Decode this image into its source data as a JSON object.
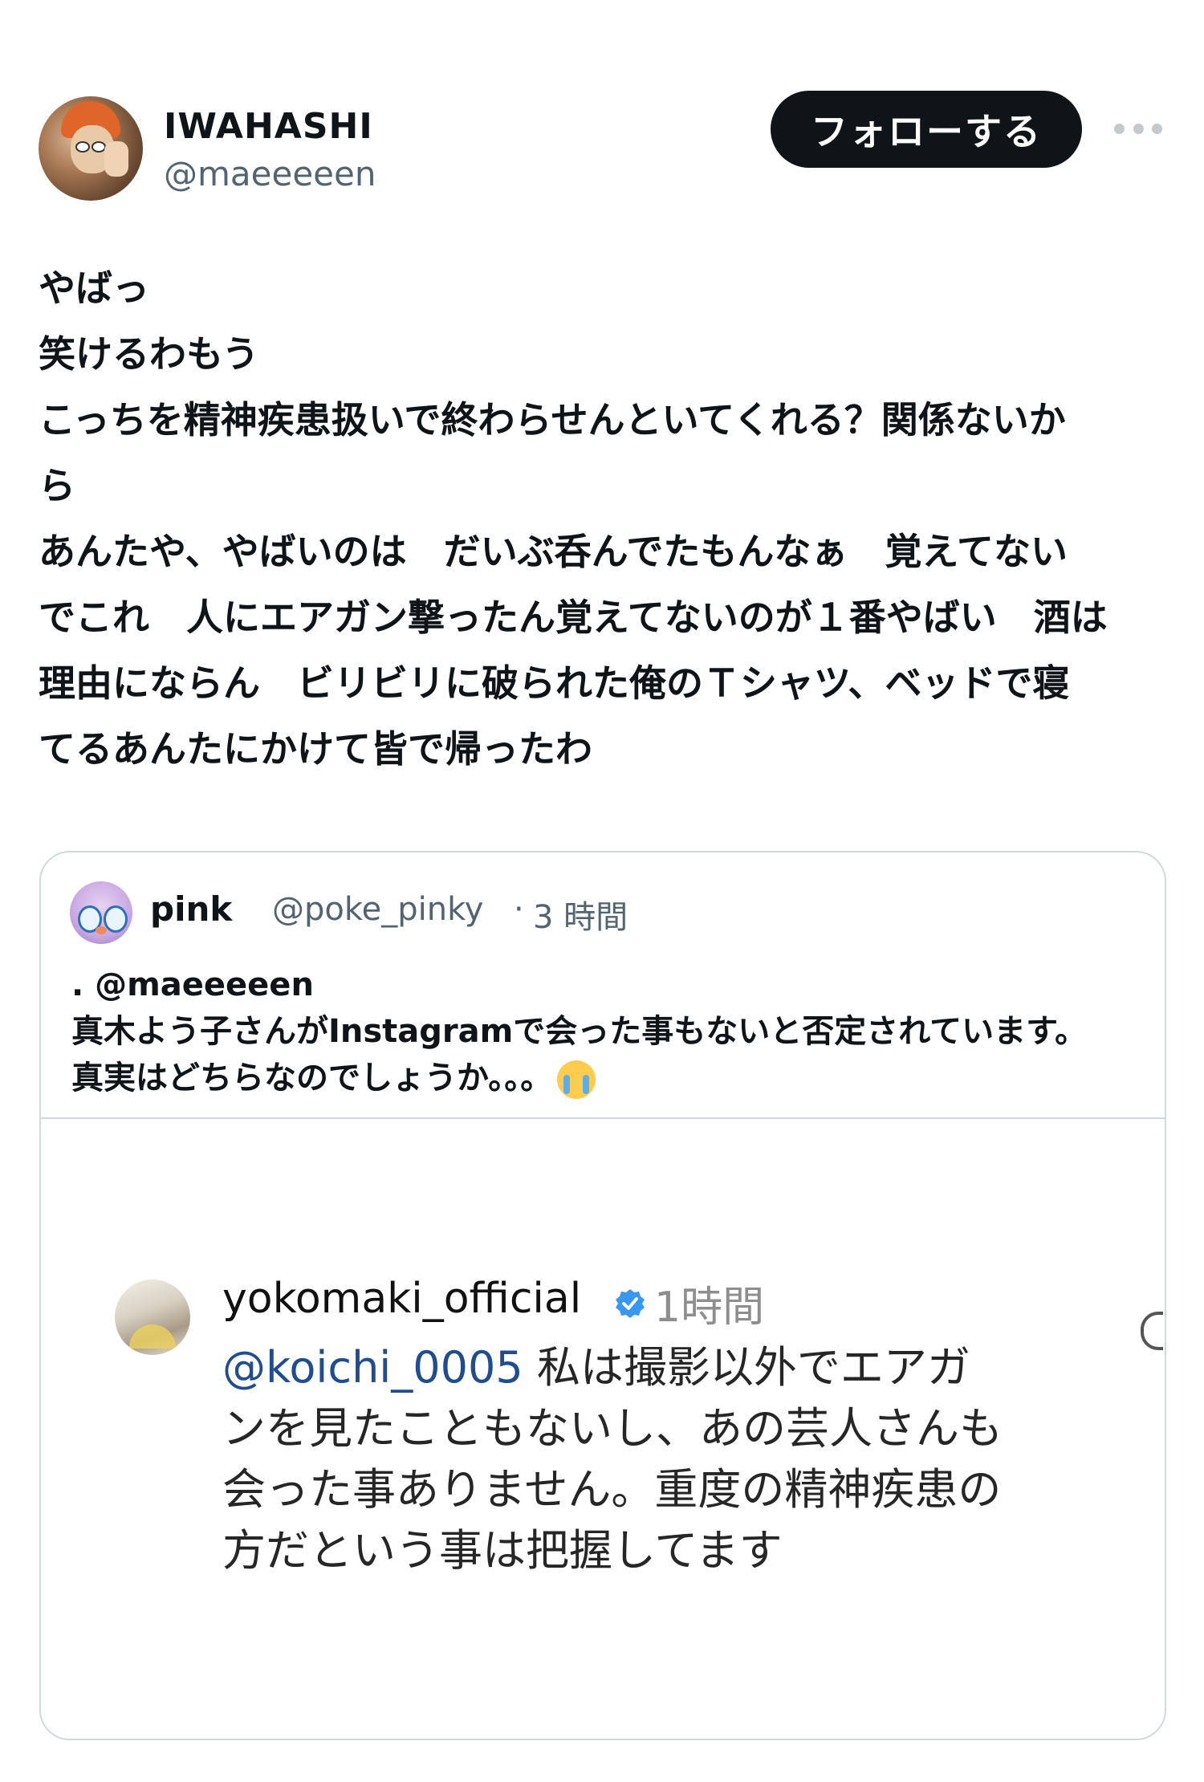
{
  "post": {
    "author": {
      "display_name": "IWAHASHI",
      "handle": "@maeeeeen"
    },
    "follow_label": "フォローする",
    "more_icon": "ellipsis-icon",
    "body_lines": [
      "やばっ",
      "笑けるわもう",
      "こっちを精神疾患扱いで終わらせんといてくれる？関係ないか",
      "ら",
      "あんたや、やばいのは　だいぶ呑んでたもんなぁ　覚えてない",
      "でこれ　人にエアガン撃ったん覚えてないのが１番やばい　酒は",
      "理由にならん　ビリビリに破られた俺のＴシャツ、ベッドで寝",
      "てるあんたにかけて皆で帰ったわ"
    ]
  },
  "quote": {
    "name": "pink",
    "handle": "@poke_pinky",
    "separator": "·",
    "time": "3 時間",
    "text_lines": [
      ". @maeeeeen",
      "真木よう子さんがInstagramで会った事もないと否定されています。",
      "真実はどちらなのでしょうか。。。"
    ],
    "emoji": "loudly-crying-face",
    "instagram_comment": {
      "username": "yokomaki_official",
      "verified_icon": "verified-badge-icon",
      "time": "1時間",
      "mention": "@koichi_0005",
      "text_lines": [
        " 私は撮影以外でエアガ",
        "ンを見たこともないし、あの芸人さんも",
        "会った事ありません。重度の精神疾患の",
        "方だという事は把握してます"
      ],
      "colors": {
        "mention": "#1f4d8f",
        "verified": "#3897f0",
        "time": "#8e8e8e"
      }
    }
  }
}
